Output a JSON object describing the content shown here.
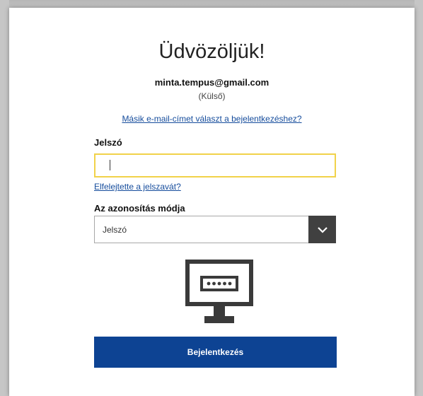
{
  "login": {
    "title": "Üdvözöljük!",
    "email": "minta.tempus@gmail.com",
    "account_type": "(Külső)",
    "other_email_link": "Másik e-mail-címet választ a bejelentkezéshez?",
    "password_label": "Jelszó",
    "password_value": "",
    "forgot_link": "Elfelejtette a jelszavát?",
    "auth_method_label": "Az azonosítás módja",
    "auth_method_selected": "Jelszó",
    "submit_label": "Bejelentkezés"
  },
  "colors": {
    "accent": "#0d4393",
    "link": "#154c9c",
    "input_focus_border": "#f1d24a",
    "select_arrow_bg": "#404040"
  },
  "icons": {
    "select_arrow": "chevron-down-icon",
    "illustration": "password-monitor-icon"
  }
}
